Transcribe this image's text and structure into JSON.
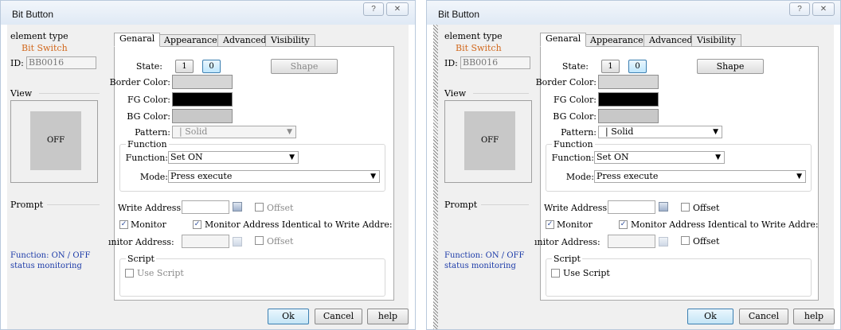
{
  "dialogs": [
    {
      "title": "Bit Button",
      "help_glyph": "?",
      "close_glyph": "✕",
      "element_type_label": "element type",
      "element_type_value": "Bit Switch",
      "id_label": "ID:",
      "id_value": "BB0016",
      "view_label": "View",
      "view_button": "OFF",
      "prompt_label": "Prompt",
      "prompt_text": "Function: ON / OFF status monitoring",
      "tabs": [
        "Genaral",
        "Appearance",
        "Advanced",
        "Visibility"
      ],
      "state_label": "State:",
      "state_1": "1",
      "state_0": "0",
      "shape_button": "Shape",
      "border_color_label": "Border Color:",
      "fg_color_label": "FG Color:",
      "bg_color_label": "BG Color:",
      "pattern_label": "Pattern:",
      "pattern_value": "Solid",
      "function_group": "Function",
      "function_label": "Function:",
      "function_value": "Set ON",
      "mode_label": "Mode:",
      "mode_value": "Press execute",
      "write_address_label": "Write Address:",
      "offset_label": "Offset",
      "monitor_label": "Monitor",
      "monitor_identical_label": "Monitor Address Identical to Write Addre:",
      "monitor_address_label": "ınitor Address:",
      "offset2_label": "Offset",
      "script_group": "Script",
      "use_script_label": "Use Script",
      "ok_button": "Ok",
      "cancel_button": "Cancel",
      "help_button": "help",
      "fg_color": "#000000",
      "border_color_swatch": "#d6d6d6",
      "bg_color_swatch": "#c8c8c8",
      "pattern_enabled": false,
      "monitor_checked": true,
      "monitor_identical_checked": true
    },
    {
      "title": "Bit Button",
      "help_glyph": "?",
      "close_glyph": "✕",
      "element_type_label": "element type",
      "element_type_value": "Bit Switch",
      "id_label": "ID:",
      "id_value": "BB0016",
      "view_label": "View",
      "view_button": "OFF",
      "prompt_label": "Prompt",
      "prompt_text": "Function: ON / OFF status monitoring",
      "tabs": [
        "Genaral",
        "Appearance",
        "Advanced",
        "Visibility"
      ],
      "state_label": "State:",
      "state_1": "1",
      "state_0": "0",
      "shape_button": "Shape",
      "border_color_label": "Border Color:",
      "fg_color_label": "FG Color:",
      "bg_color_label": "BG Color:",
      "pattern_label": "Pattern:",
      "pattern_value": "Solid",
      "function_group": "Function",
      "function_label": "Function:",
      "function_value": "Set ON",
      "mode_label": "Mode:",
      "mode_value": "Press execute",
      "write_address_label": "Write Address:",
      "offset_label": "Offset",
      "monitor_label": "Monitor",
      "monitor_identical_label": "Monitor Address Identical to Write Addre:",
      "monitor_address_label": "ınitor Address:",
      "offset2_label": "Offset",
      "script_group": "Script",
      "use_script_label": "Use Script",
      "ok_button": "Ok",
      "cancel_button": "Cancel",
      "help_button": "help",
      "fg_color": "#000000",
      "border_color_swatch": "#d6d6d6",
      "bg_color_swatch": "#c8c8c8",
      "pattern_enabled": true,
      "monitor_checked": true,
      "monitor_identical_checked": true
    }
  ]
}
